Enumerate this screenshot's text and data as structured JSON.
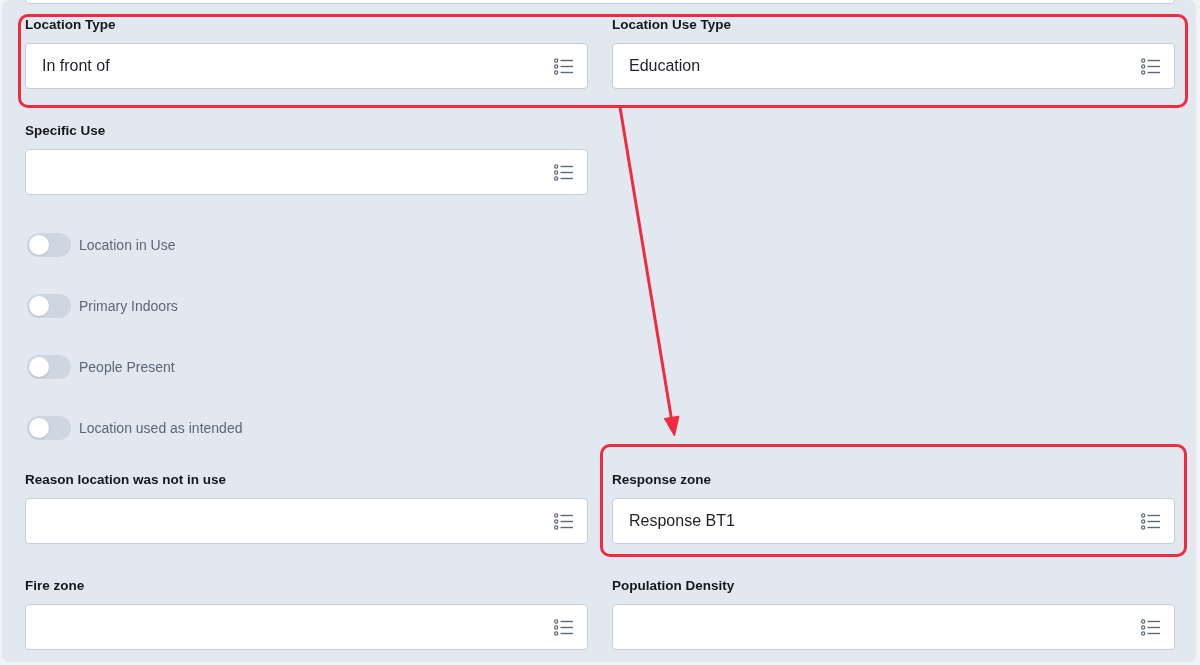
{
  "rows": [
    {
      "kind": "fields",
      "highlighted": true,
      "fields": [
        {
          "label": "Location Type",
          "value": "In front of",
          "highlighted": false
        },
        {
          "label": "Location Use Type",
          "value": "Education",
          "highlighted": false
        }
      ]
    },
    {
      "kind": "fields",
      "highlighted": false,
      "fields": [
        {
          "label": "Specific Use",
          "highlighted": false
        }
      ]
    },
    {
      "kind": "toggle",
      "label": "Location in Use",
      "on": false
    },
    {
      "kind": "toggle",
      "label": "Primary Indoors",
      "on": false
    },
    {
      "kind": "toggle",
      "label": "People Present",
      "on": false
    },
    {
      "kind": "toggle",
      "label": "Location used as intended",
      "on": false
    },
    {
      "kind": "fields",
      "highlighted": false,
      "fields": [
        {
          "label": "Reason location was not in use",
          "highlighted": false
        },
        {
          "label": "Response zone",
          "value": "Response BT1",
          "highlighted": true
        }
      ]
    },
    {
      "kind": "fields",
      "highlighted": false,
      "fields": [
        {
          "label": "Fire zone",
          "highlighted": false
        },
        {
          "label": "Population Density",
          "highlighted": false
        }
      ]
    }
  ],
  "annotation_arrow": true
}
